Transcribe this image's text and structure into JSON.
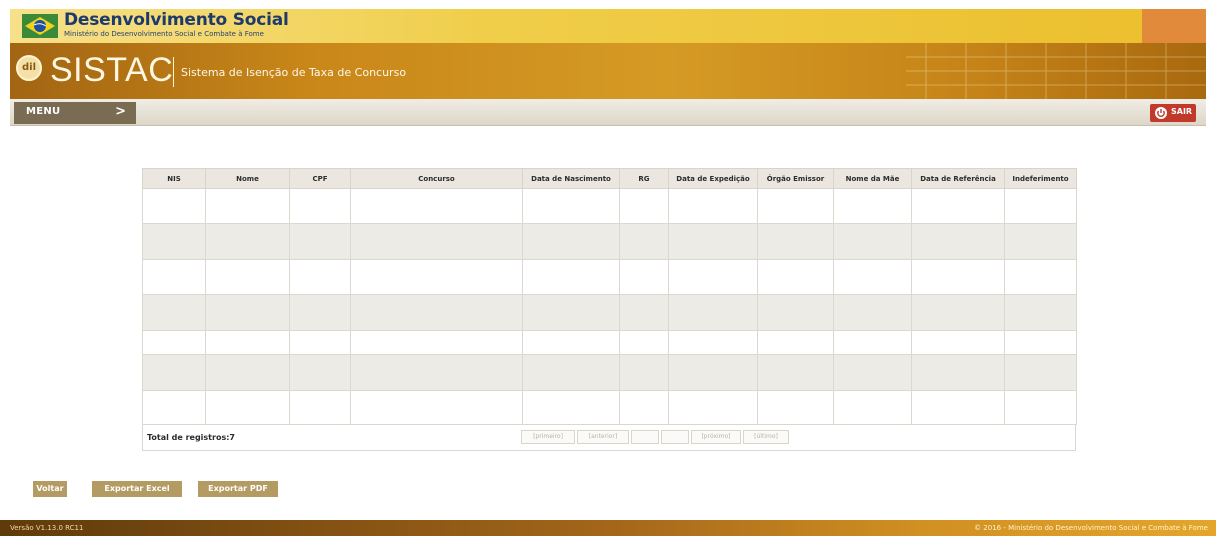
{
  "header": {
    "ministry_title": "Desenvolvimento Social",
    "ministry_subtitle": "Ministério do Desenvolvimento Social e Combate à Fome",
    "app_name": "SISTAC",
    "app_tagline": "Sistema de Isenção de Taxa de Concurso",
    "logo_text": "dil"
  },
  "menu": {
    "label": "MENU",
    "arrow": ">",
    "logout_label": "SAIR"
  },
  "table": {
    "columns": [
      "NIS",
      "Nome",
      "CPF",
      "Concurso",
      "Data de Nascimento",
      "RG",
      "Data de Expedição",
      "Órgão Emissor",
      "Nome da Mãe",
      "Data de Referência",
      "Indeferimento"
    ],
    "total_label": "Total de registros:7",
    "pagination": [
      "[primeiro]",
      "[anterior]",
      "",
      "",
      "[próximo]",
      "[último]"
    ]
  },
  "actions": {
    "back": "Voltar",
    "export_excel": "Exportar Excel",
    "export_pdf": "Exportar PDF"
  },
  "footer": {
    "version": "Versão V1.13.0 RC11",
    "copyright": "© 2016 - Ministério do Desenvolvimento Social e Combate à Fome"
  },
  "colors": {
    "brand_gold": "#d59a24",
    "menu_brown": "#7a6c53",
    "logout_red": "#c0392b",
    "button_tan": "#b39b63"
  },
  "icons": [
    "brazil-flag-icon",
    "sistac-logo-icon",
    "chevron-right-icon",
    "power-icon"
  ]
}
